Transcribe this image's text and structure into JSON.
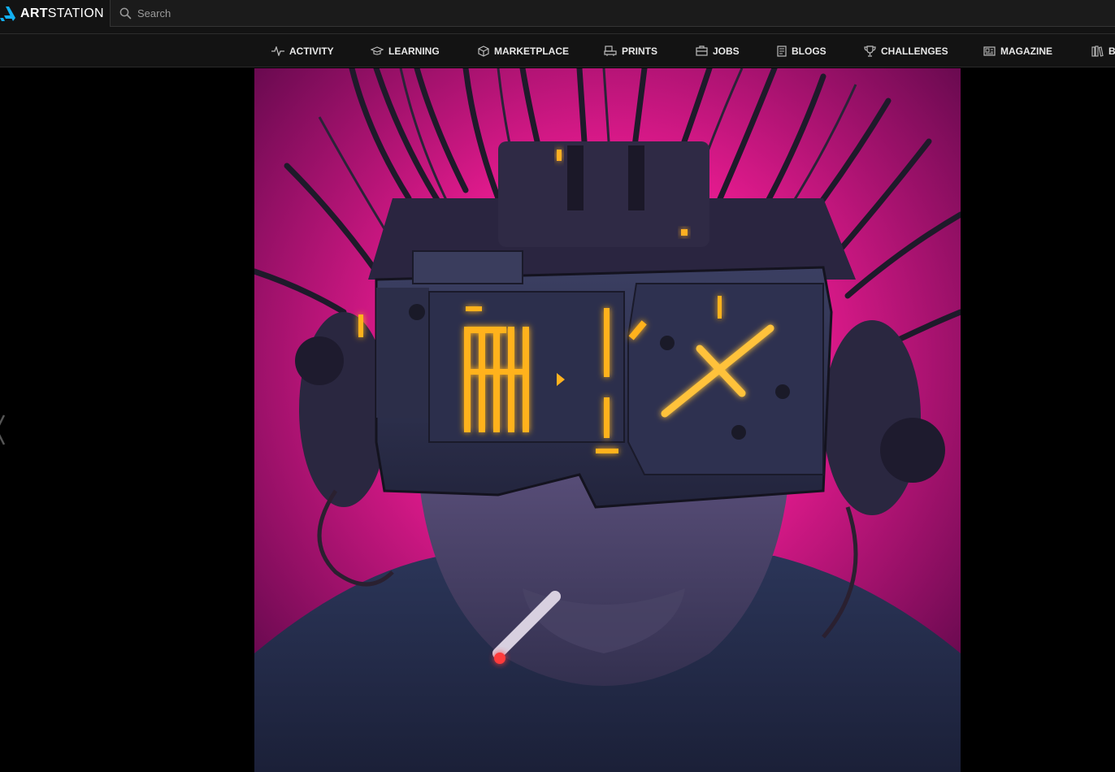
{
  "header": {
    "logo_bold": "ART",
    "logo_light": "STATION",
    "search_placeholder": "Search",
    "brand_color": "#13aff0"
  },
  "nav": {
    "items": [
      {
        "label": "ACTIVITY",
        "icon": "activity-icon"
      },
      {
        "label": "LEARNING",
        "icon": "graduation-cap-icon"
      },
      {
        "label": "MARKETPLACE",
        "icon": "box-icon"
      },
      {
        "label": "PRINTS",
        "icon": "print-icon"
      },
      {
        "label": "JOBS",
        "icon": "briefcase-icon"
      },
      {
        "label": "BLOGS",
        "icon": "document-icon"
      },
      {
        "label": "CHALLENGES",
        "icon": "trophy-icon"
      },
      {
        "label": "MAGAZINE",
        "icon": "newspaper-icon"
      },
      {
        "label": "B",
        "icon": "books-icon"
      }
    ]
  },
  "viewer": {
    "artwork_description_icon": "cyberpunk-headset-portrait",
    "prev_icon": "chevron-left-icon"
  }
}
